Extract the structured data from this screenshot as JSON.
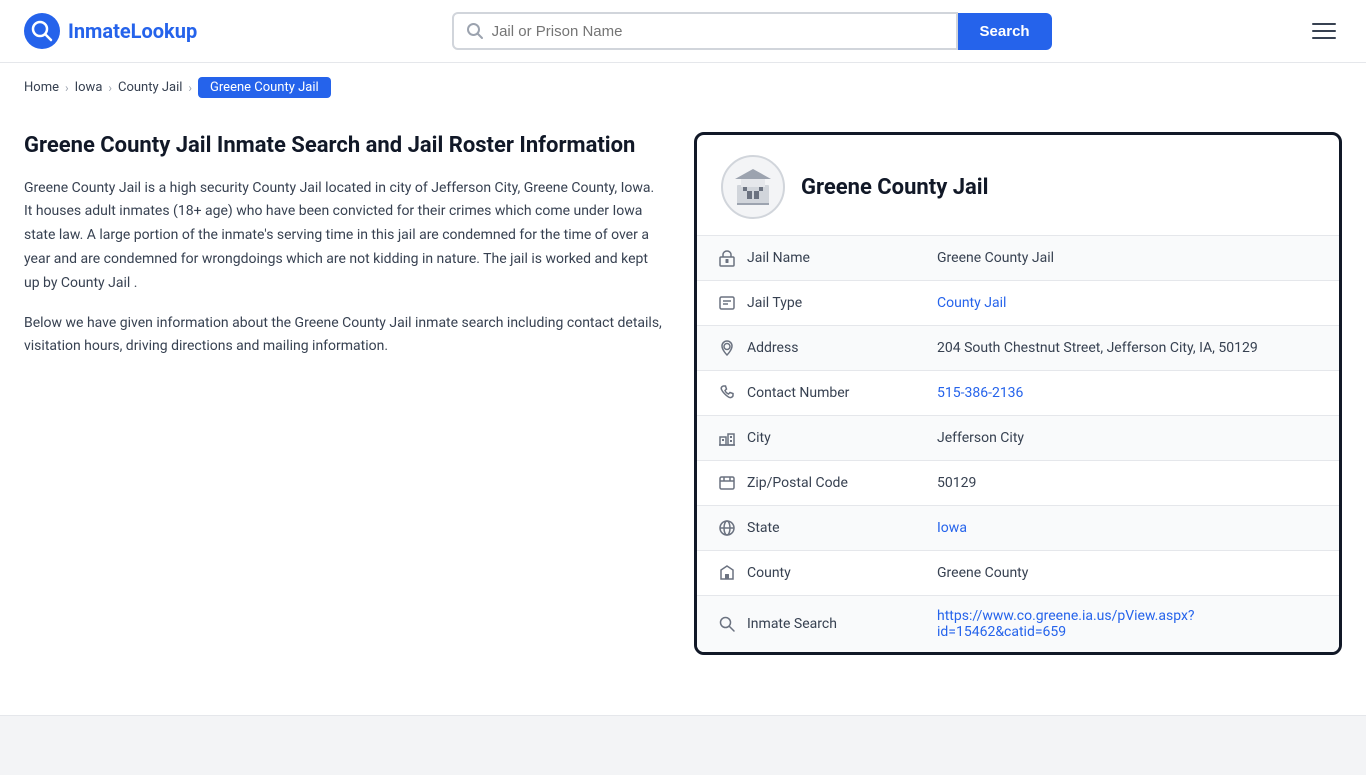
{
  "logo": {
    "icon_symbol": "Q",
    "text_prefix": "Inmate",
    "text_suffix": "Lookup"
  },
  "header": {
    "search_placeholder": "Jail or Prison Name",
    "search_button_label": "Search"
  },
  "breadcrumb": {
    "items": [
      {
        "label": "Home",
        "href": "#"
      },
      {
        "label": "Iowa",
        "href": "#"
      },
      {
        "label": "County Jail",
        "href": "#"
      }
    ],
    "current": "Greene County Jail"
  },
  "left": {
    "title": "Greene County Jail Inmate Search and Jail Roster Information",
    "description1": "Greene County Jail is a high security County Jail located in city of Jefferson City, Greene County, Iowa. It houses adult inmates (18+ age) who have been convicted for their crimes which come under Iowa state law. A large portion of the inmate's serving time in this jail are condemned for the time of over a year and are condemned for wrongdoings which are not kidding in nature. The jail is worked and kept up by County Jail .",
    "description2": "Below we have given information about the Greene County Jail inmate search including contact details, visitation hours, driving directions and mailing information."
  },
  "card": {
    "title": "Greene County Jail",
    "rows": [
      {
        "icon": "jail",
        "label": "Jail Name",
        "value": "Greene County Jail",
        "link": null
      },
      {
        "icon": "type",
        "label": "Jail Type",
        "value": "County Jail",
        "link": "#"
      },
      {
        "icon": "address",
        "label": "Address",
        "value": "204 South Chestnut Street, Jefferson City, IA, 50129",
        "link": null
      },
      {
        "icon": "phone",
        "label": "Contact Number",
        "value": "515-386-2136",
        "link": "tel:515-386-2136"
      },
      {
        "icon": "city",
        "label": "City",
        "value": "Jefferson City",
        "link": null
      },
      {
        "icon": "zip",
        "label": "Zip/Postal Code",
        "value": "50129",
        "link": null
      },
      {
        "icon": "globe",
        "label": "State",
        "value": "Iowa",
        "link": "#"
      },
      {
        "icon": "county",
        "label": "County",
        "value": "Greene County",
        "link": null
      },
      {
        "icon": "search",
        "label": "Inmate Search",
        "value": "https://www.co.greene.ia.us/pView.aspx?id=15462&catid=659",
        "link": "https://www.co.greene.ia.us/pView.aspx?id=15462&catid=659"
      }
    ]
  }
}
